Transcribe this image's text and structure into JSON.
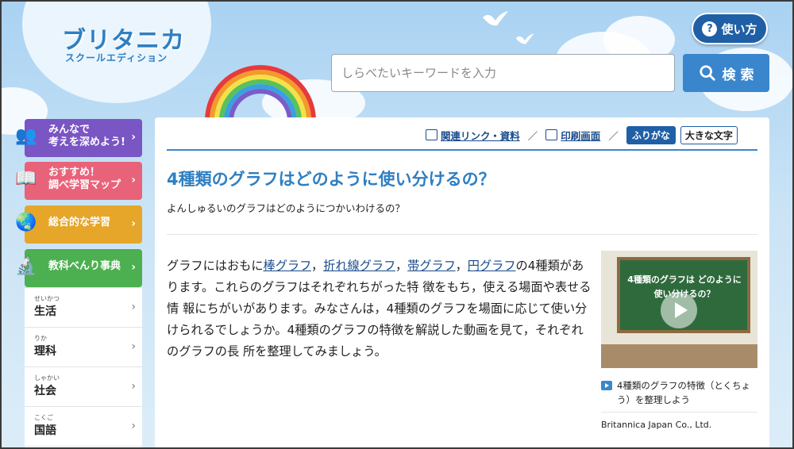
{
  "logo": {
    "main": "ブリタニカ",
    "sub": "スクールエディション"
  },
  "header": {
    "help_label": "使い方",
    "help_icon": "?"
  },
  "search": {
    "placeholder": "しらべたいキーワードを入力",
    "button_label": "検 索"
  },
  "sidebar": {
    "cards": [
      {
        "line1": "みんなで",
        "line2": "考えを深めよう!",
        "color": "#7a55c4"
      },
      {
        "line1": "おすすめ！",
        "line2": "調べ学習マップ",
        "color": "#e8637a"
      },
      {
        "line1": "総合的な学習",
        "line2": "",
        "color": "#e6a62a"
      },
      {
        "line1": "教科べんり事典",
        "line2": "",
        "color": "#4caf50"
      }
    ],
    "items": [
      {
        "ruby": "せいかつ",
        "label": "生活"
      },
      {
        "ruby": "りか",
        "label": "理科"
      },
      {
        "ruby": "しゃかい",
        "label": "社会"
      },
      {
        "ruby": "こくご",
        "label": "国語"
      }
    ]
  },
  "toolbar": {
    "related": "関連リンク・資料",
    "print": "印刷画面",
    "furigana": "ふりがな",
    "large_text": "大きな文字"
  },
  "article": {
    "title": "4種類のグラフはどのように使い分けるの？",
    "subtitle": "よんしゅるいのグラフはどのようにつかいわけるの？",
    "para_before": "グラフにはおもに",
    "links": [
      "棒グラフ",
      "折れ線グラフ",
      "帯グラフ",
      "円グラフ"
    ],
    "para_after": "の4種類があります。これらのグラフはそれぞれちがった特 徴をもち，使える場面や表せる情 報にちがいがあります。みなさんは，4種類のグラフを場面に応じて使い分けられるでしょうか。4種類のグラフの特徴を解説した動画を見て，それぞれのグラフの長 所を整理してみましょう。"
  },
  "video": {
    "board_text": "4種類のグラフは どのように使い分けるの？",
    "caption": "4種類のグラフの特徴（とくちょう）を整理しよう",
    "credit": "Britannica Japan Co., Ltd."
  }
}
